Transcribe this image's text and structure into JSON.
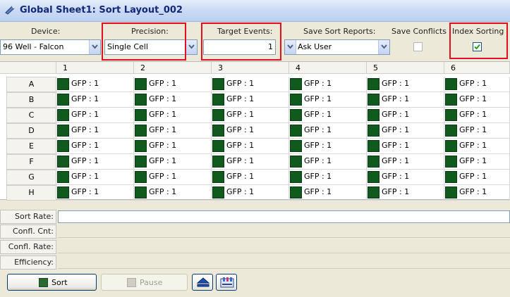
{
  "window": {
    "title": "Global Sheet1: Sort Layout_002"
  },
  "controls": {
    "device": {
      "label": "Device:",
      "value": "96 Well - Falcon"
    },
    "precision": {
      "label": "Precision:",
      "value": "Single Cell"
    },
    "target_events": {
      "label": "Target Events:",
      "value": "1"
    },
    "save_sort_reports": {
      "label": "Save Sort Reports:",
      "value": "Ask User"
    },
    "save_conflicts": {
      "label": "Save Conflicts",
      "checked": false
    },
    "index_sorting": {
      "label": "Index Sorting",
      "checked": true
    }
  },
  "grid": {
    "columns": [
      "1",
      "2",
      "3",
      "4",
      "5",
      "6"
    ],
    "rows": [
      "A",
      "B",
      "C",
      "D",
      "E",
      "F",
      "G",
      "H"
    ],
    "cell_label": "GFP : 1",
    "cell_color": "#0f5a1c"
  },
  "stats": {
    "sort_rate": "Sort Rate:",
    "confl_cnt": "Confl. Cnt:",
    "confl_rate": "Confl. Rate:",
    "efficiency": "Efficiency:"
  },
  "buttons": {
    "sort": "Sort",
    "pause": "Pause"
  },
  "icons": {
    "eject": "eject-icon",
    "plate": "plate-layout-icon"
  }
}
